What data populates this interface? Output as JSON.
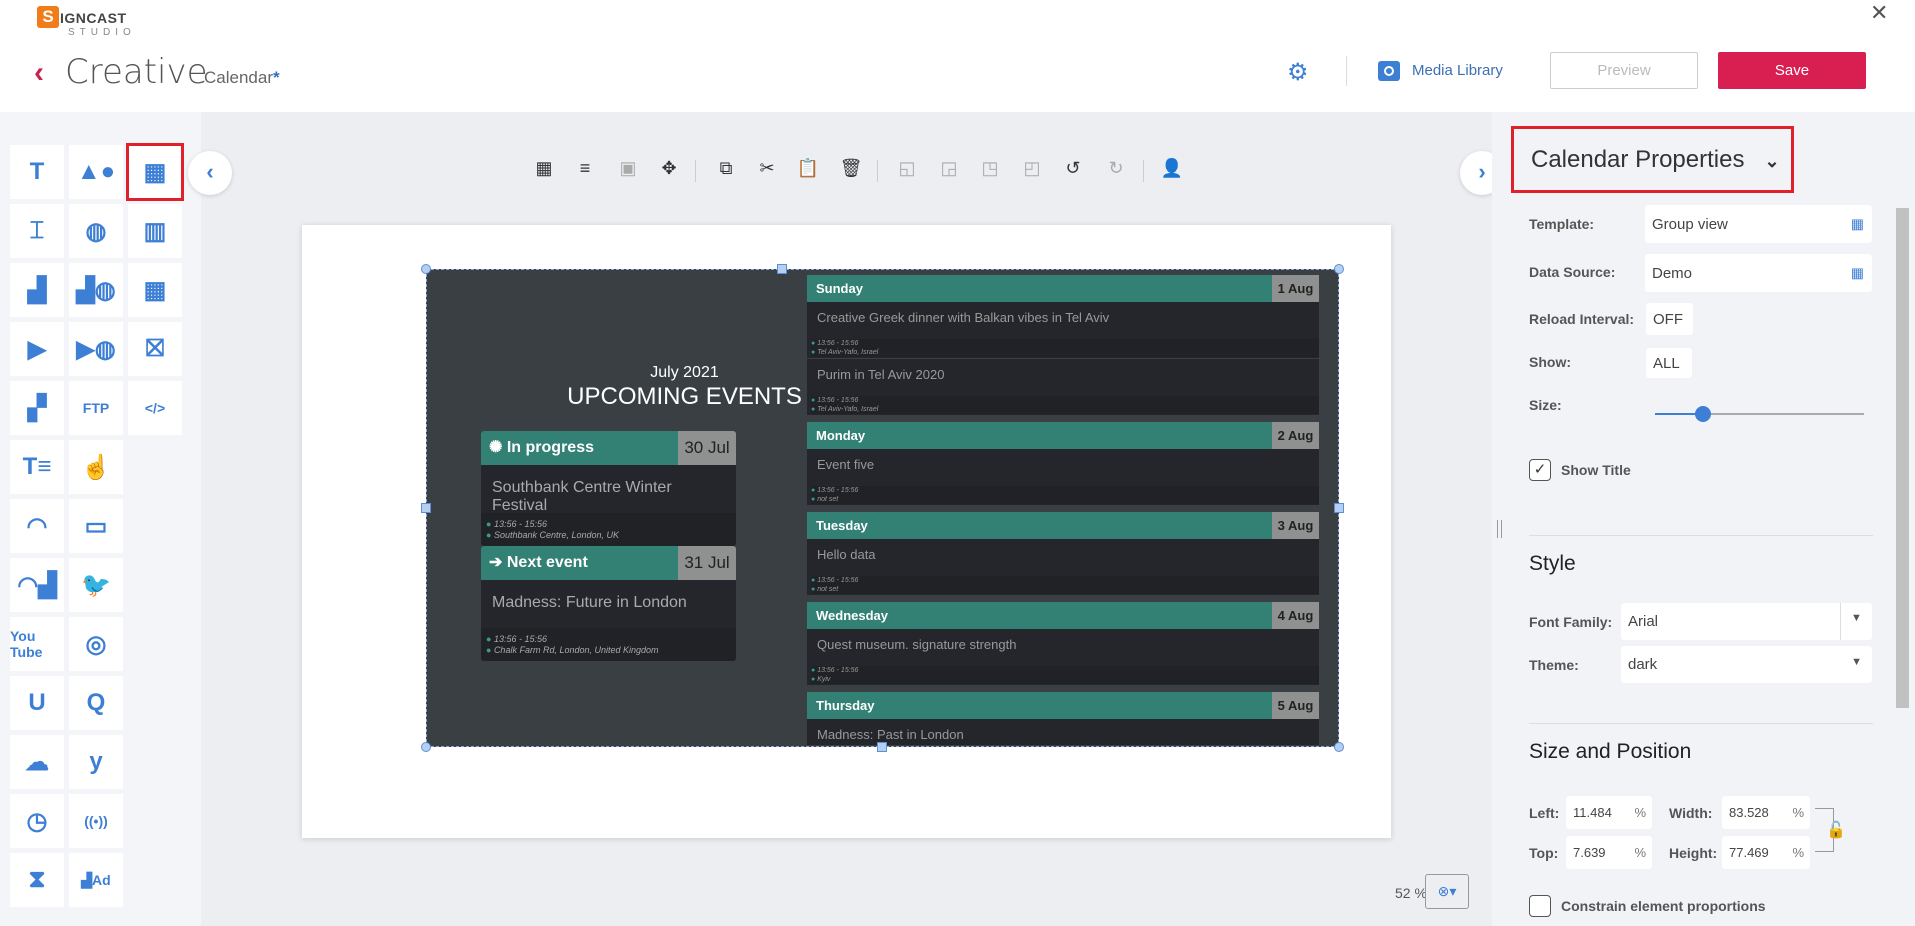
{
  "app": {
    "logo_letter": "S",
    "logo_text": "IGNCAST",
    "logo_sub": "STUDIO",
    "title": "Creative",
    "breadcrumb": "Calendar",
    "unsaved_marker": "*"
  },
  "header": {
    "media_library": "Media Library",
    "preview": "Preview",
    "save": "Save",
    "close": "✕"
  },
  "colors": {
    "accent": "#3d7fd4",
    "save": "#d91f52",
    "calendar_header": "#338075",
    "calendar_bg": "#3a3f44"
  },
  "sidebar": {
    "items": [
      "text",
      "shapes",
      "calendar",
      "text-box",
      "web",
      "chart",
      "image",
      "web-image",
      "table",
      "video",
      "web-video",
      "construction",
      "slideshow",
      "FTP",
      "html-code",
      "ticker-text",
      "touch",
      "rss",
      "screen",
      "rss-image",
      "twitter",
      "YouTube",
      "instagram",
      "u-widget",
      "q-widget",
      "weather",
      "yammer",
      "clock",
      "broadcast",
      "countdown",
      "ad-image"
    ],
    "selected": "calendar",
    "ftp_label": "FTP",
    "youtube_label": "You Tube",
    "u_label": "U",
    "q_label": "Q",
    "ad_label": "Ad"
  },
  "toolbar": {
    "tools": [
      "grid",
      "align",
      "fit",
      "move",
      "copy",
      "cut",
      "paste",
      "delete",
      "send-back",
      "send-backward",
      "bring-forward",
      "bring-front",
      "undo",
      "redo",
      "add-user"
    ],
    "disabled": [
      "fit",
      "send-back",
      "send-backward",
      "bring-forward",
      "bring-front",
      "redo"
    ]
  },
  "widget": {
    "subtitle": "July 2021",
    "title": "UPCOMING EVENTS",
    "cards": [
      {
        "label": "In progress",
        "date": "30 Jul",
        "event": "Southbank Centre Winter Festival",
        "time": "13:56 - 15:56",
        "location": "Southbank Centre, London, UK"
      },
      {
        "label": "Next event",
        "date": "31 Jul",
        "event": "Madness: Future in London",
        "time": "13:56 - 15:56",
        "location": "Chalk Farm Rd, London, United Kingdom"
      }
    ],
    "days": [
      {
        "day": "Sunday",
        "date": "1 Aug",
        "events": [
          {
            "title": "Creative Greek dinner with Balkan vibes in Tel Aviv",
            "time": "13:56 - 15:56",
            "location": "Tel Aviv-Yafo, Israel"
          },
          {
            "title": "Purim in Tel Aviv 2020",
            "time": "13:56 - 15:56",
            "location": "Tel Aviv-Yafo, Israel"
          }
        ]
      },
      {
        "day": "Monday",
        "date": "2 Aug",
        "events": [
          {
            "title": "Event five",
            "time": "13:56 - 15:56",
            "location": "not set"
          }
        ]
      },
      {
        "day": "Tuesday",
        "date": "3 Aug",
        "events": [
          {
            "title": "Hello data",
            "time": "13:56 - 15:56",
            "location": "not set"
          }
        ]
      },
      {
        "day": "Wednesday",
        "date": "4 Aug",
        "events": [
          {
            "title": "Quest museum. signature strength",
            "time": "13:56 - 15:56",
            "location": "Kyiv"
          }
        ]
      },
      {
        "day": "Thursday",
        "date": "5 Aug",
        "events": [
          {
            "title": "Madness: Past in London",
            "time": "",
            "location": ""
          }
        ]
      }
    ]
  },
  "zoom": {
    "value": "52 %"
  },
  "panel": {
    "title": "Calendar Properties",
    "template_label": "Template:",
    "template": "Group view",
    "source_label": "Data Source:",
    "source": "Demo",
    "reload_label": "Reload Interval:",
    "reload": "OFF",
    "show_label": "Show:",
    "show": "ALL",
    "size_label": "Size:",
    "size_fraction": 0.23,
    "show_title_label": "Show Title",
    "show_title": true,
    "style_heading": "Style",
    "font_label": "Font Family:",
    "font": "Arial",
    "theme_label": "Theme:",
    "theme": "dark",
    "sp_heading": "Size and Position",
    "left_label": "Left:",
    "left": "11.484",
    "top_label": "Top:",
    "top": "7.639",
    "width_label": "Width:",
    "width": "83.528",
    "height_label": "Height:",
    "height": "77.469",
    "unit": "%",
    "constrain_label": "Constrain element proportions",
    "constrain": false
  }
}
